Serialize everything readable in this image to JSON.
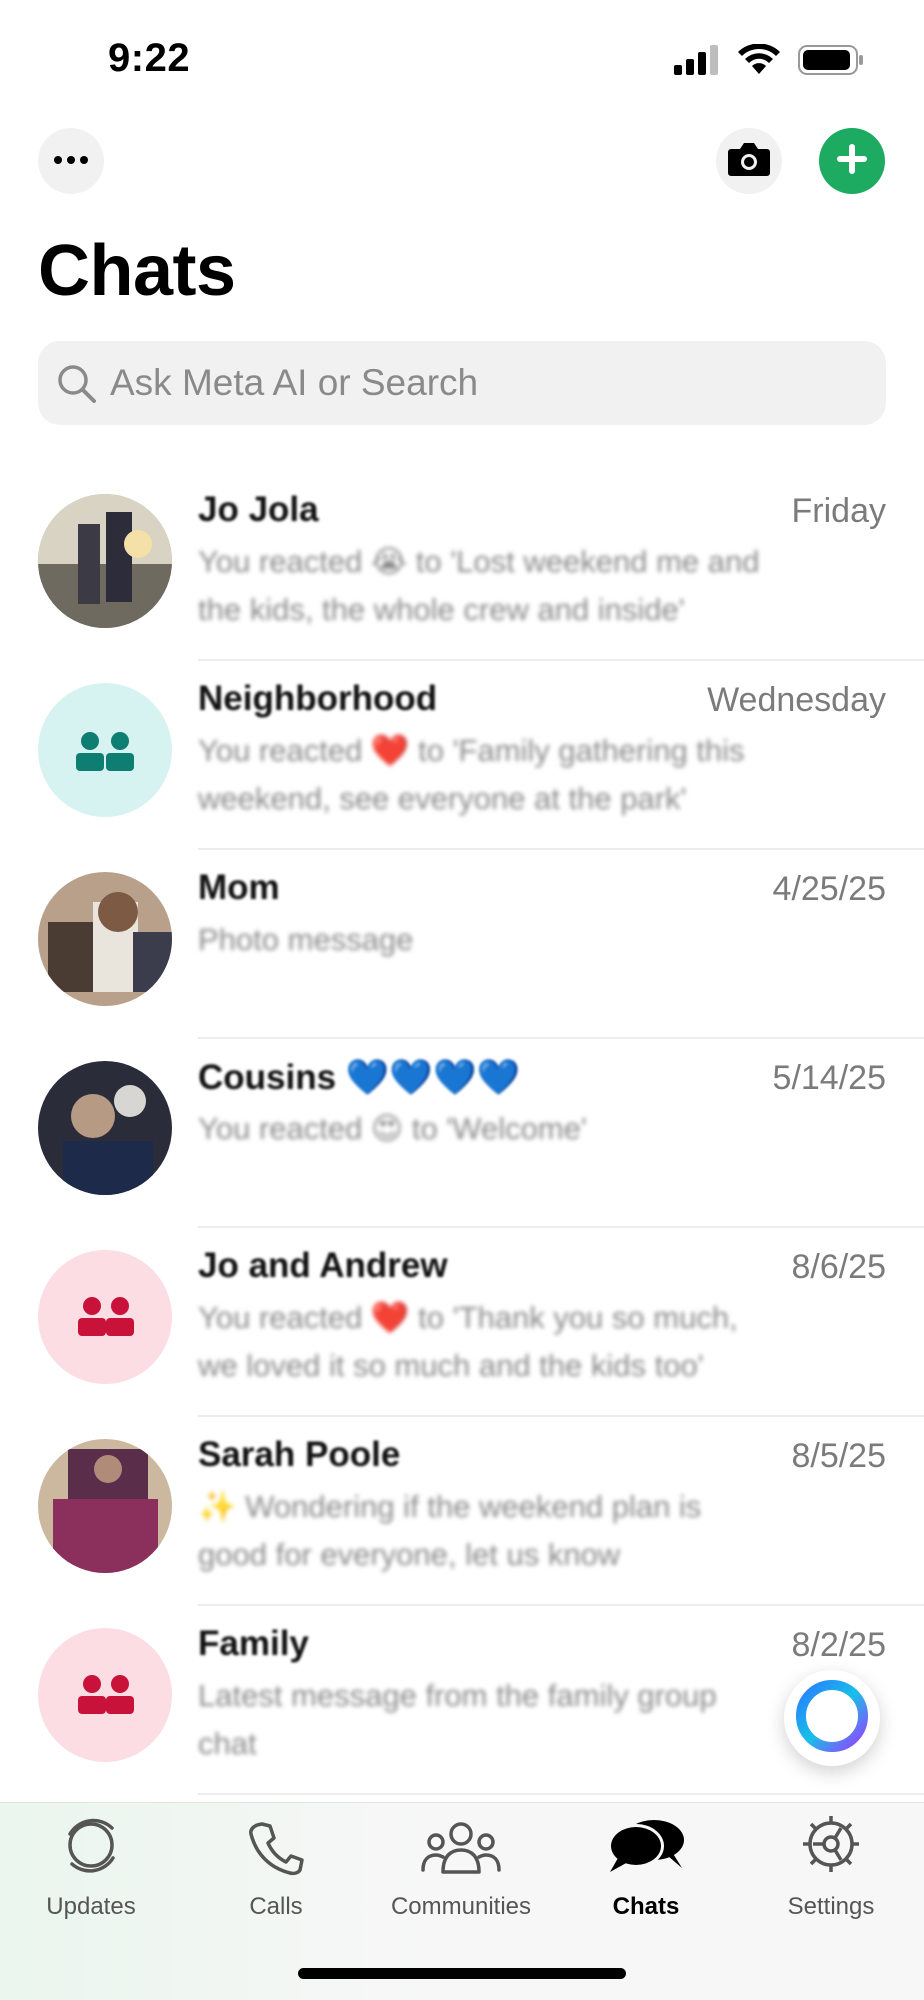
{
  "status": {
    "time": "9:22"
  },
  "page": {
    "title": "Chats"
  },
  "search": {
    "placeholder": "Ask Meta AI or Search"
  },
  "chats": [
    {
      "name": "Jo Jola",
      "time": "Friday",
      "preview": "You reacted 😭 to 'Lost weekend me and the kids, the whole crew and inside'",
      "avatar": "photo"
    },
    {
      "name": "Neighborhood",
      "time": "Wednesday",
      "preview": "You reacted ❤️ to 'Family gathering this weekend, see everyone at the park'",
      "avatar": "group-teal"
    },
    {
      "name": "Mom",
      "time": "4/25/25",
      "preview": "Photo message",
      "avatar": "photo"
    },
    {
      "name": "Cousins 💙💙💙💙",
      "time": "5/14/25",
      "preview": "You reacted 😍 to 'Welcome'",
      "avatar": "photo"
    },
    {
      "name": "Jo and Andrew",
      "time": "8/6/25",
      "preview": "You reacted ❤️ to 'Thank you so much, we loved it so much and the kids too'",
      "avatar": "group-pink"
    },
    {
      "name": "Sarah Poole",
      "time": "8/5/25",
      "preview": "✨ Wondering if the weekend plan is good for everyone, let us know",
      "avatar": "photo"
    },
    {
      "name": "Family",
      "time": "8/2/25",
      "preview": "Latest message from the family group chat",
      "avatar": "group-pink"
    }
  ],
  "tabs": [
    {
      "label": "Updates",
      "icon": "updates-icon"
    },
    {
      "label": "Calls",
      "icon": "phone-icon"
    },
    {
      "label": "Communities",
      "icon": "communities-icon"
    },
    {
      "label": "Chats",
      "icon": "chats-icon",
      "active": true
    },
    {
      "label": "Settings",
      "icon": "gear-icon"
    }
  ],
  "colors": {
    "accent": "#1daa61",
    "teal_group": "#d7f3f1",
    "pink_group": "#fbdde3"
  }
}
